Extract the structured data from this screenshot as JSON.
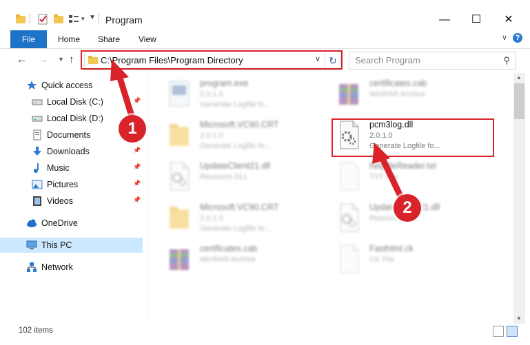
{
  "window": {
    "title": "Program",
    "controls": {
      "minimize": "—",
      "maximize": "☐",
      "close": "✕"
    }
  },
  "ribbon": {
    "tabs": [
      "File",
      "Home",
      "Share",
      "View"
    ],
    "help": "?"
  },
  "nav": {
    "address": "C:\\Program Files\\Program Directory",
    "search_placeholder": "Search Program"
  },
  "sidebar": {
    "items": [
      {
        "label": "Quick access",
        "icon": "star-icon",
        "pinned": false
      },
      {
        "label": "Local Disk (C:)",
        "icon": "drive-icon",
        "pinned": true
      },
      {
        "label": "Local Disk (D:)",
        "icon": "drive-icon",
        "pinned": false
      },
      {
        "label": "Documents",
        "icon": "documents-icon",
        "pinned": true
      },
      {
        "label": "Downloads",
        "icon": "download-icon",
        "pinned": true
      },
      {
        "label": "Music",
        "icon": "music-icon",
        "pinned": true
      },
      {
        "label": "Pictures",
        "icon": "pictures-icon",
        "pinned": true
      },
      {
        "label": "Videos",
        "icon": "videos-icon",
        "pinned": true
      },
      {
        "label": "OneDrive",
        "icon": "cloud-icon",
        "pinned": false
      },
      {
        "label": "This PC",
        "icon": "computer-icon",
        "pinned": false,
        "selected": true
      },
      {
        "label": "Network",
        "icon": "network-icon",
        "pinned": false
      }
    ]
  },
  "files": [
    {
      "name": "program.exe",
      "line1": "2.0.1.0",
      "line2": "Generate Logfile fo...",
      "type": "exe"
    },
    {
      "name": "certificates.cab",
      "line1": "WinRAR Archive",
      "line2": "",
      "type": "archive"
    },
    {
      "name": "Microsoft.VC90.CRT",
      "line1": "2.0.1.0",
      "line2": "Generate Logfile fo...",
      "type": "folder"
    },
    {
      "name": "pcm3log.dll",
      "line1": "2.0.1.0",
      "line2": "Generate Logfile fo...",
      "type": "dll",
      "selected": true
    },
    {
      "name": "UpdateClient21.dll",
      "line1": "Resource DLL",
      "line2": "",
      "type": "dll"
    },
    {
      "name": "helpfileReader.txt",
      "line1": "TXT File",
      "line2": "",
      "type": "txt"
    },
    {
      "name": "Microsoft.VC90.CRT",
      "line1": "2.0.1.0",
      "line2": "Generate Logfile fo...",
      "type": "folder"
    },
    {
      "name": "UpdateClient21.dll",
      "line1": "Resource DLL",
      "line2": "",
      "type": "dll"
    },
    {
      "name": "certificates.cab",
      "line1": "WinRAR Archive",
      "line2": "",
      "type": "archive"
    },
    {
      "name": "Fasthtml.ck",
      "line1": "CK File",
      "line2": "",
      "type": "generic"
    }
  ],
  "status": {
    "item_count": "102 items"
  },
  "annotations": {
    "step1": "1",
    "step2": "2"
  },
  "colors": {
    "accent": "#1e73c8",
    "highlight": "#d8232a",
    "selection": "#cce8ff"
  }
}
